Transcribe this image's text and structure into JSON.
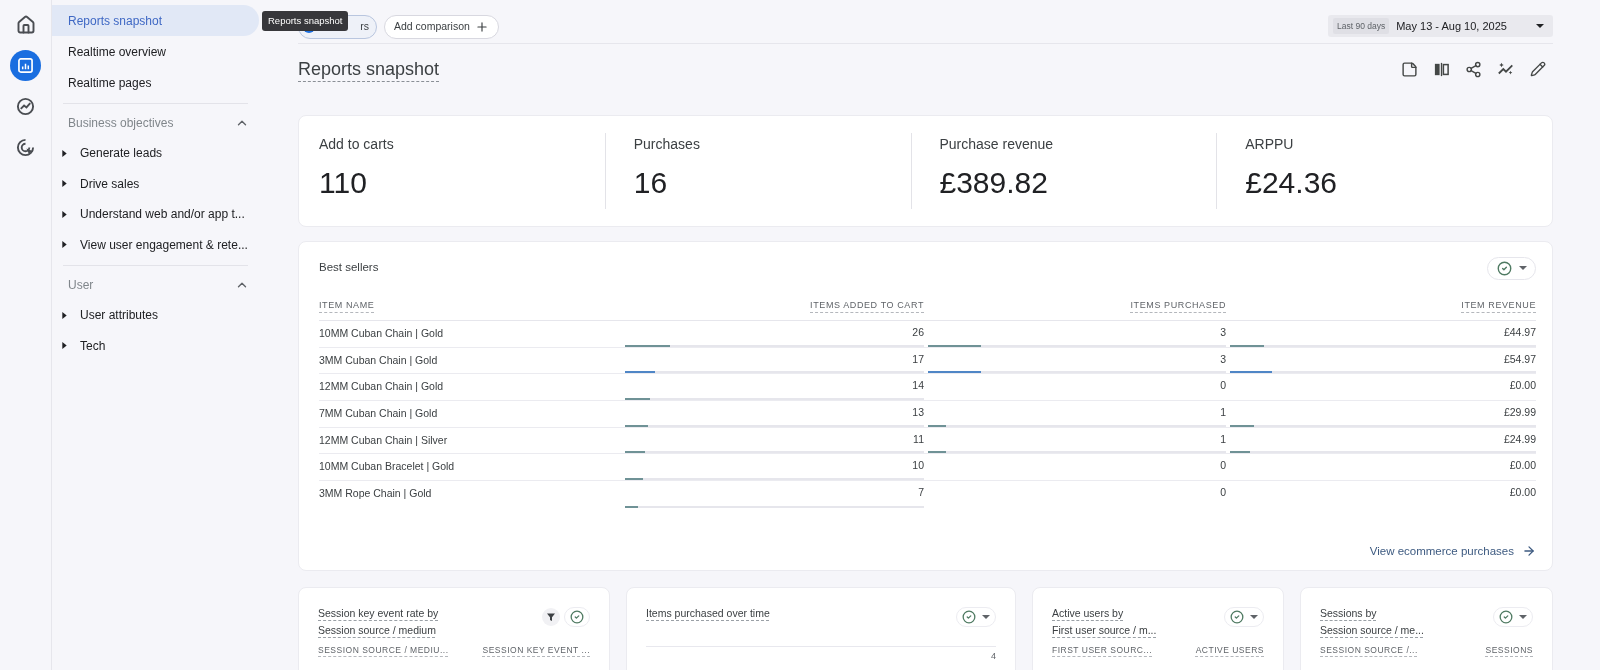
{
  "rail": {
    "items": [
      {
        "selected": false
      },
      {
        "selected": true
      },
      {
        "selected": false
      },
      {
        "selected": false
      }
    ]
  },
  "nav": {
    "items": [
      {
        "label": "Reports snapshot",
        "selected": true
      },
      {
        "label": "Realtime overview",
        "selected": false
      },
      {
        "label": "Realtime pages",
        "selected": false
      }
    ],
    "sections": [
      {
        "title": "Business objectives",
        "expanded": true,
        "items": [
          {
            "label": "Generate leads",
            "expanded": false
          },
          {
            "label": "Drive sales",
            "expanded": false
          },
          {
            "label": "Understand web and/or app t...",
            "expanded": false
          },
          {
            "label": "View user engagement & rete...",
            "expanded": false
          }
        ]
      },
      {
        "title": "User",
        "expanded": true,
        "items": [
          {
            "label": "User attributes",
            "expanded": false
          },
          {
            "label": "Tech",
            "expanded": false
          }
        ]
      }
    ]
  },
  "tooltip": {
    "text": "Reports snapshot"
  },
  "toolbar": {
    "segment_chip": {
      "label": "rs"
    },
    "comparison_button": {
      "label": "Add comparison"
    },
    "date_range": {
      "preset": "Last 90 days",
      "range": "May 13 - Aug 10, 2025"
    }
  },
  "page_title": "Reports snapshot",
  "kpis": [
    {
      "label": "Add to carts",
      "value": "110"
    },
    {
      "label": "Purchases",
      "value": "16"
    },
    {
      "label": "Purchase revenue",
      "value": "£389.82"
    },
    {
      "label": "ARPPU",
      "value": "£24.36"
    }
  ],
  "best_sellers": {
    "title": "Best sellers",
    "columns": [
      "ITEM NAME",
      "ITEMS ADDED TO CART",
      "ITEMS PURCHASED",
      "ITEM REVENUE"
    ],
    "rows": [
      {
        "item_name": "10MM Cuban Chain | Gold",
        "highlighted": false,
        "metrics": [
          {
            "value": "26",
            "level": 0.152
          },
          {
            "value": "3",
            "level": 0.179
          },
          {
            "value": "£44.97",
            "level": 0.112
          }
        ]
      },
      {
        "item_name": "3MM Cuban Chain | Gold",
        "highlighted": true,
        "metrics": [
          {
            "value": "17",
            "level": 0.099
          },
          {
            "value": "3",
            "level": 0.179
          },
          {
            "value": "£54.97",
            "level": 0.138
          }
        ]
      },
      {
        "item_name": "12MM Cuban Chain | Gold",
        "highlighted": false,
        "metrics": [
          {
            "value": "14",
            "level": 0.083
          },
          {
            "value": "0"
          },
          {
            "value": "£0.00"
          }
        ]
      },
      {
        "item_name": "7MM Cuban Chain | Gold",
        "highlighted": false,
        "metrics": [
          {
            "value": "13",
            "level": 0.076
          },
          {
            "value": "1",
            "level": 0.06
          },
          {
            "value": "£29.99",
            "level": 0.077
          }
        ]
      },
      {
        "item_name": "12MM Cuban Chain | Silver",
        "highlighted": false,
        "metrics": [
          {
            "value": "11",
            "level": 0.066
          },
          {
            "value": "1",
            "level": 0.06
          },
          {
            "value": "£24.99",
            "level": 0.064
          }
        ]
      },
      {
        "item_name": "10MM Cuban Bracelet | Gold",
        "highlighted": false,
        "metrics": [
          {
            "value": "10",
            "level": 0.06
          },
          {
            "value": "0"
          },
          {
            "value": "£0.00"
          }
        ]
      },
      {
        "item_name": "3MM Rope Chain | Gold",
        "highlighted": false,
        "metrics": [
          {
            "value": "7",
            "level": 0.043
          },
          {
            "value": "0"
          },
          {
            "value": "£0.00"
          }
        ]
      }
    ],
    "link": {
      "label": "View ecommerce purchases"
    }
  },
  "cards": [
    {
      "title_lines": [
        "Session key event rate by",
        "Session source / medium"
      ],
      "filtered": true,
      "menu": false,
      "columns": [
        "SESSION SOURCE / MEDIU...",
        "SESSION KEY EVENT ..."
      ]
    },
    {
      "title_lines": [
        "Items purchased over time"
      ],
      "filtered": false,
      "menu": true,
      "y_tick": "4"
    },
    {
      "title_lines": [
        "Active users by",
        "First user source / m..."
      ],
      "filtered": false,
      "menu": true,
      "columns": [
        "FIRST USER SOURC...",
        "ACTIVE USERS"
      ]
    },
    {
      "title_lines": [
        "Sessions by",
        "Session source / me..."
      ],
      "filtered": false,
      "menu": true,
      "columns": [
        "SESSION SOURCE /...",
        "SESSIONS"
      ]
    }
  ]
}
